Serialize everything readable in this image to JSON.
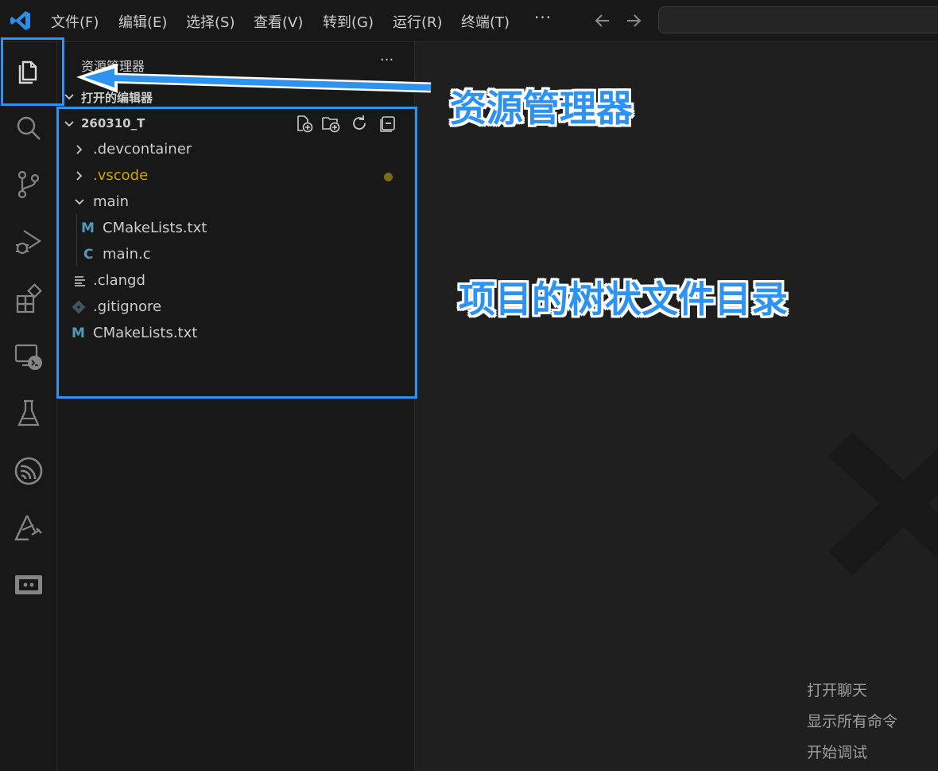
{
  "titlebar": {
    "menu": [
      "文件(F)",
      "编辑(E)",
      "选择(S)",
      "查看(V)",
      "转到(G)",
      "运行(R)",
      "终端(T)"
    ],
    "more": "···",
    "logo_icon": "vscode-logo-icon",
    "accent": "#2e92f0"
  },
  "activity_bar": {
    "items": [
      "explorer-icon",
      "search-icon",
      "source-control-icon",
      "run-debug-icon",
      "extensions-icon",
      "remote-explorer-icon",
      "testing-icon",
      "esp-idf-icon",
      "platformio-icon",
      "serial-monitor-icon"
    ]
  },
  "sidebar": {
    "title": "资源管理器",
    "more": "···",
    "open_editors_label": "打开的编辑器",
    "project": {
      "name": "260310_T",
      "toolbar_icons": [
        "new-file-icon",
        "new-folder-icon",
        "refresh-icon",
        "collapse-all-icon"
      ]
    },
    "tree": [
      {
        "label": ".devcontainer",
        "type": "folder-collapsed"
      },
      {
        "label": ".vscode",
        "type": "folder-collapsed",
        "modified": true,
        "color": "#cca700"
      },
      {
        "label": "main",
        "type": "folder-expanded"
      },
      {
        "label": "CMakeLists.txt",
        "type": "cmake-file",
        "icon_text": "M"
      },
      {
        "label": "main.c",
        "type": "c-file",
        "icon_text": "C"
      },
      {
        "label": ".clangd",
        "type": "text-file"
      },
      {
        "label": ".gitignore",
        "type": "git-file"
      },
      {
        "label": "CMakeLists.txt",
        "type": "cmake-file",
        "icon_text": "M"
      }
    ]
  },
  "editor": {
    "hints": [
      "打开聊天",
      "显示所有命令",
      "开始调试"
    ]
  },
  "annotations": {
    "explorer_label": "资源管理器",
    "tree_label": "项目的树状文件目录",
    "color": "#2e92f0"
  }
}
